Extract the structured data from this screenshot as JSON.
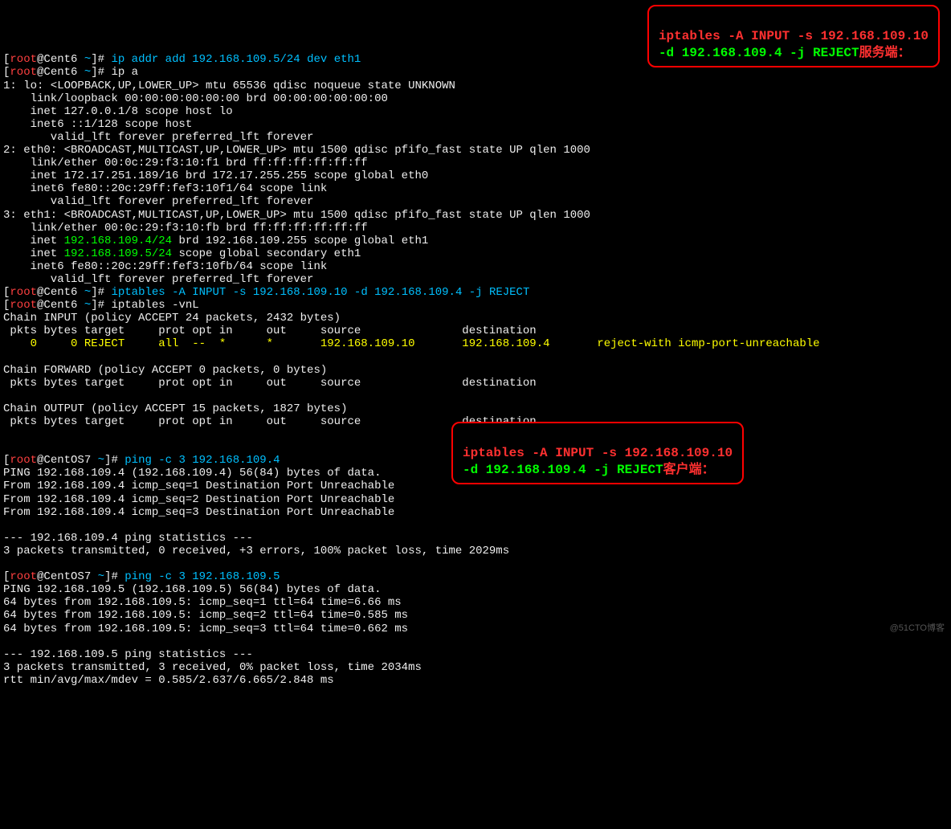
{
  "watermark": "@51CTO博客",
  "callout1": {
    "line1": "iptables -A INPUT -s 192.168.109.10",
    "line2a": "-d 192.168.109.4 -j REJECT",
    "line2b": "服务端："
  },
  "callout2": {
    "line1": "iptables -A INPUT -s 192.168.109.10",
    "line2a": "-d 192.168.109.4 -j REJECT",
    "line2b": "客户端："
  },
  "p1": {
    "br": "[",
    "user": "root",
    "at": "@",
    "host": "Cent6 ",
    "tilde": "~",
    "end": "]# ",
    "cmd": "ip addr add 192.168.109.5/24 dev eth1"
  },
  "p2": {
    "br": "[",
    "user": "root",
    "at": "@",
    "host": "Cent6 ",
    "tilde": "~",
    "end": "]# ",
    "cmd": "ip a"
  },
  "ipa": {
    "lo1": "1: lo: <LOOPBACK,UP,LOWER_UP> mtu 65536 qdisc noqueue state UNKNOWN",
    "lo2": "    link/loopback 00:00:00:00:00:00 brd 00:00:00:00:00:00",
    "lo3": "    inet 127.0.0.1/8 scope host lo",
    "lo4": "    inet6 ::1/128 scope host",
    "lo5": "       valid_lft forever preferred_lft forever",
    "e0a": "2: eth0: <BROADCAST,MULTICAST,UP,LOWER_UP> mtu 1500 qdisc pfifo_fast state UP qlen 1000",
    "e0b": "    link/ether 00:0c:29:f3:10:f1 brd ff:ff:ff:ff:ff:ff",
    "e0c": "    inet 172.17.251.189/16 brd 172.17.255.255 scope global eth0",
    "e0d": "    inet6 fe80::20c:29ff:fef3:10f1/64 scope link",
    "e0e": "       valid_lft forever preferred_lft forever",
    "e1a": "3: eth1: <BROADCAST,MULTICAST,UP,LOWER_UP> mtu 1500 qdisc pfifo_fast state UP qlen 1000",
    "e1b": "    link/ether 00:0c:29:f3:10:fb brd ff:ff:ff:ff:ff:ff",
    "e1c_pre": "    inet ",
    "e1c_ip": "192.168.109.4/24",
    "e1c_post": " brd 192.168.109.255 scope global eth1",
    "e1d_pre": "    inet ",
    "e1d_ip": "192.168.109.5/24",
    "e1d_post": " scope global secondary eth1",
    "e1e": "    inet6 fe80::20c:29ff:fef3:10fb/64 scope link",
    "e1f": "       valid_lft forever preferred_lft forever"
  },
  "p3": {
    "br": "[",
    "user": "root",
    "at": "@",
    "host": "Cent6 ",
    "tilde": "~",
    "end": "]# ",
    "cmd": "iptables -A INPUT -s 192.168.109.10 -d 192.168.109.4 -j REJECT"
  },
  "p4": {
    "br": "[",
    "user": "root",
    "at": "@",
    "host": "Cent6 ",
    "tilde": "~",
    "end": "]# ",
    "cmd": "iptables -vnL"
  },
  "ipt": {
    "c1": "Chain INPUT (policy ACCEPT 24 packets, 2432 bytes)",
    "h1": " pkts bytes target     prot opt in     out     source               destination",
    "r1": "    0     0 REJECT     all  --  *      *       192.168.109.10       192.168.109.4       reject-with icmp-port-unreachable",
    "c2": "Chain FORWARD (policy ACCEPT 0 packets, 0 bytes)",
    "h2": " pkts bytes target     prot opt in     out     source               destination",
    "c3": "Chain OUTPUT (policy ACCEPT 15 packets, 1827 bytes)",
    "h3": " pkts bytes target     prot opt in     out     source               destination"
  },
  "p5": {
    "br": "[",
    "user": "root",
    "at": "@",
    "host": "CentOS7 ",
    "tilde": "~",
    "end": "]# ",
    "cmd": "ping -c 3 192.168.109.4"
  },
  "ping1": {
    "l1": "PING 192.168.109.4 (192.168.109.4) 56(84) bytes of data.",
    "l2": "From 192.168.109.4 icmp_seq=1 Destination Port Unreachable",
    "l3": "From 192.168.109.4 icmp_seq=2 Destination Port Unreachable",
    "l4": "From 192.168.109.4 icmp_seq=3 Destination Port Unreachable",
    "l5": "--- 192.168.109.4 ping statistics ---",
    "l6": "3 packets transmitted, 0 received, +3 errors, 100% packet loss, time 2029ms"
  },
  "p6": {
    "br": "[",
    "user": "root",
    "at": "@",
    "host": "CentOS7 ",
    "tilde": "~",
    "end": "]# ",
    "cmd": "ping -c 3 192.168.109.5"
  },
  "ping2": {
    "l1": "PING 192.168.109.5 (192.168.109.5) 56(84) bytes of data.",
    "l2": "64 bytes from 192.168.109.5: icmp_seq=1 ttl=64 time=6.66 ms",
    "l3": "64 bytes from 192.168.109.5: icmp_seq=2 ttl=64 time=0.585 ms",
    "l4": "64 bytes from 192.168.109.5: icmp_seq=3 ttl=64 time=0.662 ms",
    "l5": "--- 192.168.109.5 ping statistics ---",
    "l6": "3 packets transmitted, 3 received, 0% packet loss, time 2034ms",
    "l7": "rtt min/avg/max/mdev = 0.585/2.637/6.665/2.848 ms"
  }
}
